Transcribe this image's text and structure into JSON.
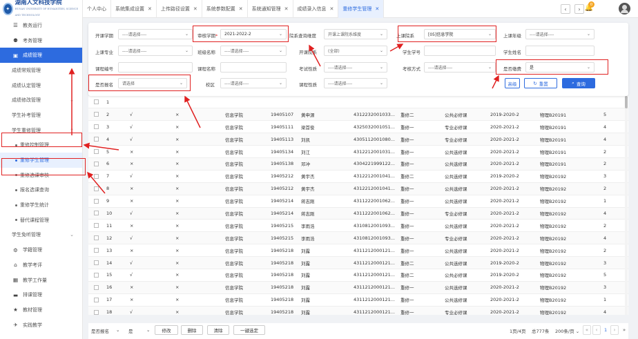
{
  "app": {
    "name": "湖南人文科技学院",
    "subtitle": "HUNAN UNIVERSITY OF HUMANITIES, SCIENCE AND TECHNOLOGY"
  },
  "sidebar": {
    "items": [
      {
        "label": "教务运行",
        "icon": "list-icon"
      },
      {
        "label": "考务管理",
        "icon": "person-icon"
      },
      {
        "label": "成绩管理",
        "icon": "briefcase-icon",
        "active": true
      },
      {
        "label": "成绩常规管理"
      },
      {
        "label": "成绩认定管理"
      },
      {
        "label": "成绩修改管理"
      },
      {
        "label": "学生补考管理"
      },
      {
        "label": "学生重修管理",
        "expanded": true
      },
      {
        "label": "重修控制管理",
        "sub": true
      },
      {
        "label": "重修学生管理",
        "sub": true,
        "current": true
      },
      {
        "label": "重修选课审核",
        "sub": true
      },
      {
        "label": "报名选课查询",
        "sub": true
      },
      {
        "label": "重修学生统计",
        "sub": true
      },
      {
        "label": "替代课程管理",
        "sub": true
      },
      {
        "label": "学生免听管理"
      },
      {
        "label": "学籍管理",
        "icon": "gear-icon"
      },
      {
        "label": "教学考评",
        "icon": "home-icon"
      },
      {
        "label": "教学工作量",
        "icon": "grid-icon"
      },
      {
        "label": "排课管理",
        "icon": "bus-icon"
      },
      {
        "label": "教材管理",
        "icon": "star-icon"
      },
      {
        "label": "实践教学",
        "icon": "plane-icon"
      }
    ]
  },
  "tabs": [
    {
      "label": "个人中心",
      "closable": false
    },
    {
      "label": "系统集成设置",
      "closable": true
    },
    {
      "label": "上传路径设置",
      "closable": true
    },
    {
      "label": "系统参数配置",
      "closable": true
    },
    {
      "label": "系统通知管理",
      "closable": true
    },
    {
      "label": "成绩录入信息",
      "closable": true
    },
    {
      "label": "重修学生管理",
      "closable": true,
      "active": true
    }
  ],
  "notifications": {
    "count": "0"
  },
  "filters": {
    "placeholder": "----请选择----",
    "kaikuan_xueqi": {
      "label": "开课学期"
    },
    "shenhe_xueqi": {
      "label": "审核学期",
      "required_mark": "*",
      "value": "2021-2022-2"
    },
    "yuanxi_chaxun": {
      "label": "院系查询维度",
      "value": "开课上课院系维度"
    },
    "shangke_yuanxi": {
      "label": "上课院系",
      "value": "[05]信息学院"
    },
    "shangke_nianji": {
      "label": "上课年级"
    },
    "shangke_zhuanye": {
      "label": "上课专业"
    },
    "banji_mingcheng": {
      "label": "班级名称"
    },
    "kaike_yuanxi": {
      "label": "开课院系",
      "value": "(全部)"
    },
    "xuesheng_xuehao": {
      "label": "学生学号"
    },
    "xuesheng_xingming": {
      "label": "学生姓名"
    },
    "kecheng_bianhao": {
      "label": "课程编号"
    },
    "kecheng_mingcheng": {
      "label": "课程名称"
    },
    "kaoshi_xingzhi": {
      "label": "考试性质"
    },
    "kaohe_fangshi": {
      "label": "考核方式"
    },
    "shifou_jiaofei": {
      "label": "是否缴费",
      "value": "是"
    },
    "shifou_baoming": {
      "label": "是否报名",
      "value": "请选择"
    },
    "xiaoqu": {
      "label": "校区"
    },
    "kecheng_xingzhi": {
      "label": "课程性质"
    },
    "buttons": {
      "advanced": "高级",
      "reset": "重置",
      "query": "查询"
    }
  },
  "table": {
    "rows": [
      [
        "1",
        "",
        "",
        "",
        "",
        "",
        "",
        "",
        "",
        "",
        "",
        "",
        ""
      ],
      [
        "2",
        "√",
        "×",
        "信息学院",
        "19405107",
        "黄申源",
        "4312232001033...",
        "重修二",
        "公共必修课",
        "2019-2020-2",
        "物理B20191",
        "5"
      ],
      [
        "3",
        "√",
        "×",
        "信息学院",
        "19405111",
        "梁首俊",
        "4325032001051...",
        "重修一",
        "专业必修课",
        "2020-2021-2",
        "物理B20191",
        "4"
      ],
      [
        "4",
        "√",
        "×",
        "信息学院",
        "19405113",
        "刘凯",
        "4305112001080...",
        "重修一",
        "专业必修课",
        "2020-2021-2",
        "物理B20191",
        "4"
      ],
      [
        "5",
        "×",
        "×",
        "信息学院",
        "19405134",
        "刘江",
        "4312212001031...",
        "重修一",
        "公共选修课",
        "2020-2021-2",
        "物理B20191",
        "2"
      ],
      [
        "6",
        "×",
        "×",
        "信息学院",
        "19405138",
        "邓冲",
        "4304221999122...",
        "重修一",
        "公共选修课",
        "2020-2021-2",
        "物理B20191",
        "2"
      ],
      [
        "7",
        "√",
        "×",
        "信息学院",
        "19405212",
        "黄宇杰",
        "4312212001041...",
        "重修二",
        "公共选修课",
        "2019-2020-2",
        "物理B20192",
        "3"
      ],
      [
        "8",
        "×",
        "×",
        "信息学院",
        "19405212",
        "黄宇杰",
        "4312212001041...",
        "重修一",
        "公共选修课",
        "2020-2021-2",
        "物理B20192",
        "2"
      ],
      [
        "9",
        "×",
        "×",
        "信息学院",
        "19405214",
        "蒋志刚",
        "4311222001062...",
        "重修一",
        "公共选修课",
        "2020-2021-2",
        "物理B20192",
        "1"
      ],
      [
        "10",
        "√",
        "×",
        "信息学院",
        "19405214",
        "蒋志刚",
        "4311222001062...",
        "重修一",
        "专业必修课",
        "2020-2021-2",
        "物理B20192",
        "4"
      ],
      [
        "11",
        "×",
        "×",
        "信息学院",
        "19405215",
        "李雨浩",
        "4310812001093...",
        "重修一",
        "公共选修课",
        "2020-2021-2",
        "物理B20192",
        "2"
      ],
      [
        "12",
        "√",
        "×",
        "信息学院",
        "19405215",
        "李雨浩",
        "4310812001093...",
        "重修一",
        "专业必修课",
        "2020-2021-2",
        "物理B20192",
        "4"
      ],
      [
        "13",
        "×",
        "×",
        "信息学院",
        "19405218",
        "刘露",
        "4311212000121...",
        "重修一",
        "公共选修课",
        "2020-2021-2",
        "物理B20192",
        "2"
      ],
      [
        "14",
        "√",
        "×",
        "信息学院",
        "19405218",
        "刘露",
        "4311212000121...",
        "重修二",
        "公共选修课",
        "2019-2020-2",
        "物理B20192",
        "3"
      ],
      [
        "15",
        "√",
        "×",
        "信息学院",
        "19405218",
        "刘露",
        "4311212000121...",
        "重修二",
        "公共必修课",
        "2019-2020-2",
        "物理B20192",
        "5"
      ],
      [
        "16",
        "×",
        "×",
        "信息学院",
        "19405218",
        "刘露",
        "4311212000121...",
        "重修一",
        "公共选修课",
        "2020-2021-2",
        "物理B20192",
        "3"
      ],
      [
        "17",
        "×",
        "×",
        "信息学院",
        "19405218",
        "刘露",
        "4311212000121...",
        "重修一",
        "公共选修课",
        "2020-2021-2",
        "物理B20192",
        "1"
      ],
      [
        "18",
        "√",
        "×",
        "信息学院",
        "19405218",
        "刘露",
        "4311212000121...",
        "重修一",
        "专业必修课",
        "2020-2021-2",
        "物理B20192",
        "4"
      ],
      [
        "19",
        "√",
        "×",
        "信息学院",
        "19405224",
        "曹艳红",
        "4302232001021...",
        "重修一",
        "公共必修课",
        "2019-2020-2",
        "物理B20192",
        "4"
      ]
    ]
  },
  "footer": {
    "field_label": "是否报名",
    "field_value": "是",
    "modify": "修改",
    "delete": "删除",
    "clear": "清除",
    "one_click": "一键选定",
    "page_info": "1页/4页",
    "total": "总777条",
    "page_size": "200条/页",
    "current_page": "1"
  },
  "colors": {
    "primary": "#2d6bdf",
    "annotation_red": "#e02020"
  }
}
